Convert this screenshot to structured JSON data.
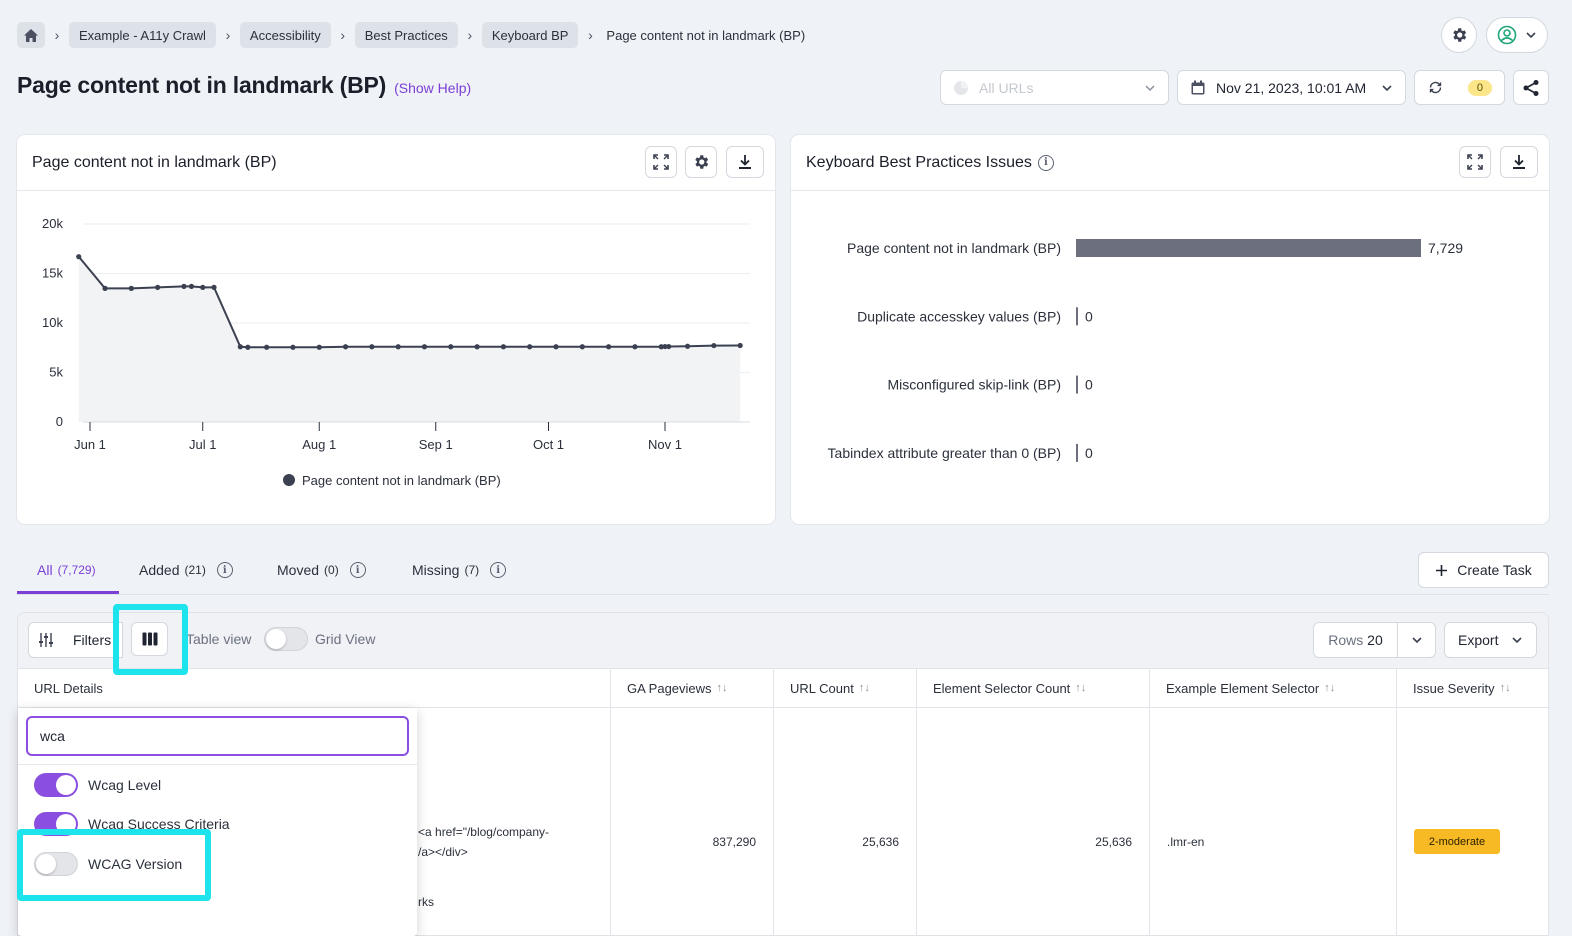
{
  "breadcrumb": [
    "Example - A11y Crawl",
    "Accessibility",
    "Best Practices",
    "Keyboard BP",
    "Page content not in landmark (BP)"
  ],
  "page": {
    "title": "Page content not in landmark (BP)",
    "show_help": "(Show Help)"
  },
  "header": {
    "segment_placeholder": "All URLs",
    "crawl_date": "Nov 21, 2023, 10:01 AM",
    "refresh_badge": "0"
  },
  "trend_card": {
    "title": "Page content not in landmark (BP)",
    "legend": "Page content not in landmark (BP)"
  },
  "issues_card": {
    "title": "Keyboard Best Practices Issues"
  },
  "chart_data": [
    {
      "type": "line",
      "title": "Page content not in landmark (BP)",
      "y_ticks": [
        "0",
        "5k",
        "10k",
        "15k",
        "20k"
      ],
      "ylim": [
        0,
        20000
      ],
      "x_ticks": [
        "Jun 1",
        "Jul 1",
        "Aug 1",
        "Sep 1",
        "Oct 1",
        "Nov 1"
      ],
      "x_tick_dates": [
        "2023-06-01",
        "2023-07-01",
        "2023-08-01",
        "2023-09-01",
        "2023-10-01",
        "2023-11-01"
      ],
      "grid": true,
      "legend_position": "bottom",
      "series": [
        {
          "name": "Page content not in landmark (BP)",
          "color": "#3b4150",
          "points": [
            [
              "2023-05-29",
              16700
            ],
            [
              "2023-06-05",
              13500
            ],
            [
              "2023-06-12",
              13500
            ],
            [
              "2023-06-19",
              13600
            ],
            [
              "2023-06-26",
              13700
            ],
            [
              "2023-06-28",
              13700
            ],
            [
              "2023-07-01",
              13600
            ],
            [
              "2023-07-04",
              13600
            ],
            [
              "2023-07-11",
              7600
            ],
            [
              "2023-07-13",
              7550
            ],
            [
              "2023-07-18",
              7550
            ],
            [
              "2023-07-25",
              7550
            ],
            [
              "2023-08-01",
              7550
            ],
            [
              "2023-08-08",
              7600
            ],
            [
              "2023-08-15",
              7600
            ],
            [
              "2023-08-22",
              7600
            ],
            [
              "2023-08-29",
              7600
            ],
            [
              "2023-09-05",
              7600
            ],
            [
              "2023-09-12",
              7600
            ],
            [
              "2023-09-19",
              7600
            ],
            [
              "2023-09-26",
              7600
            ],
            [
              "2023-10-03",
              7600
            ],
            [
              "2023-10-10",
              7600
            ],
            [
              "2023-10-17",
              7600
            ],
            [
              "2023-10-24",
              7600
            ],
            [
              "2023-10-31",
              7600
            ],
            [
              "2023-11-01",
              7620
            ],
            [
              "2023-11-02",
              7620
            ],
            [
              "2023-11-07",
              7650
            ],
            [
              "2023-11-14",
              7720
            ],
            [
              "2023-11-21",
              7729
            ]
          ]
        }
      ]
    },
    {
      "type": "bar",
      "orientation": "horizontal",
      "title": "Keyboard Best Practices Issues",
      "categories": [
        "Page content not in landmark (BP)",
        "Duplicate accesskey values (BP)",
        "Misconfigured skip-link (BP)",
        "Tabindex attribute greater than 0 (BP)"
      ],
      "values": [
        7729,
        0,
        0,
        0
      ],
      "value_labels": [
        "7,729",
        "0",
        "0",
        "0"
      ],
      "color": "#6b6f7e"
    }
  ],
  "tabs": [
    {
      "label": "All",
      "count": "(7,729)"
    },
    {
      "label": "Added",
      "count": "(21)"
    },
    {
      "label": "Moved",
      "count": "(0)"
    },
    {
      "label": "Missing",
      "count": "(7)"
    }
  ],
  "create_task": "Create Task",
  "toolbar": {
    "filters": "Filters",
    "table_view": "Table view",
    "grid_view": "Grid View",
    "rows_label": "Rows",
    "rows_value": "20",
    "export": "Export"
  },
  "columns": [
    "URL Details",
    "GA Pageviews",
    "URL Count",
    "Element Selector Count",
    "Example Element Selector",
    "Issue Severity"
  ],
  "row": {
    "url_snippet_1": "<a href=\"/blog/company-",
    "url_snippet_2": "/a></div>",
    "url_snippet_3": "rks",
    "ga_pageviews": "837,290",
    "url_count": "25,636",
    "element_selector_count": "25,636",
    "example_selector": ".lmr-en",
    "severity": "2-moderate"
  },
  "column_picker": {
    "search_value": "wca",
    "options": [
      {
        "label": "Wcag Level",
        "on": true
      },
      {
        "label": "Wcag Success Criteria",
        "on": true
      },
      {
        "label": "WCAG Version",
        "on": false
      }
    ]
  },
  "colors": {
    "accent": "#7b3fd6",
    "highlight": "#1de3ec",
    "severity_moderate": "#f7b924"
  }
}
